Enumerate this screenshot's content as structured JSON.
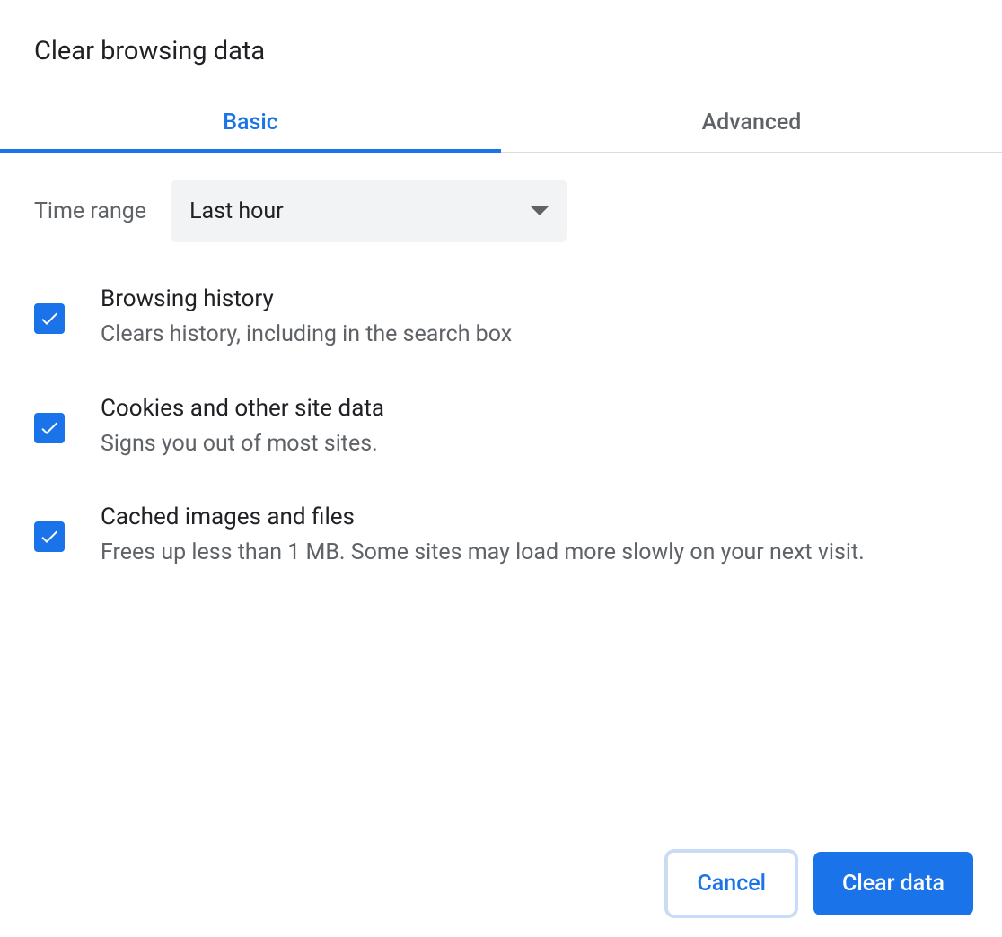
{
  "dialog": {
    "title": "Clear browsing data"
  },
  "tabs": {
    "basic": "Basic",
    "advanced": "Advanced"
  },
  "timeRange": {
    "label": "Time range",
    "value": "Last hour"
  },
  "options": [
    {
      "title": "Browsing history",
      "description": "Clears history, including in the search box",
      "checked": true
    },
    {
      "title": "Cookies and other site data",
      "description": "Signs you out of most sites.",
      "checked": true
    },
    {
      "title": "Cached images and files",
      "description": "Frees up less than 1 MB. Some sites may load more slowly on your next visit.",
      "checked": true
    }
  ],
  "footer": {
    "cancel": "Cancel",
    "clear": "Clear data"
  }
}
